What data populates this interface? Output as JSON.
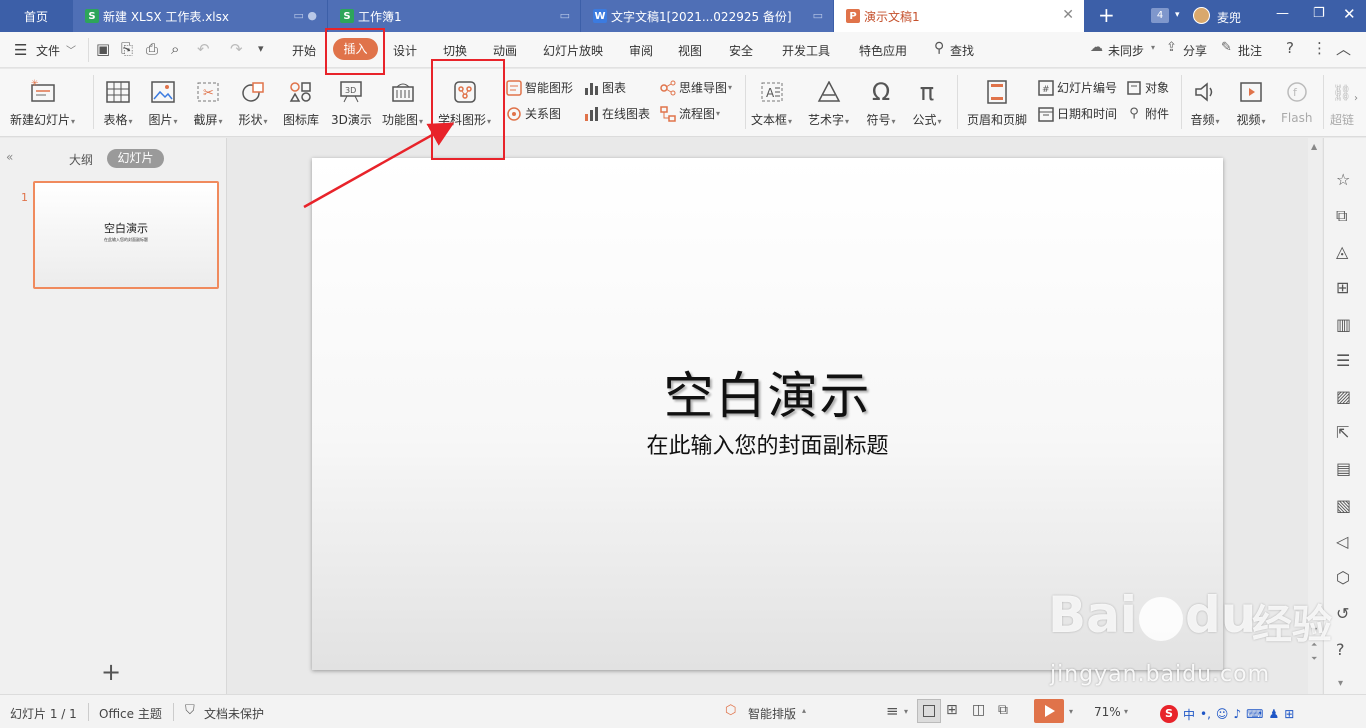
{
  "tabs": {
    "home": "首页",
    "tab1": "新建 XLSX 工作表.xlsx",
    "tab2": "工作簿1",
    "tab3": "文字文稿1[2021...022925 备份]",
    "tab4": "演示文稿1",
    "badge": "4",
    "user": "麦兜"
  },
  "menu": {
    "file": "文件",
    "items": [
      "开始",
      "插入",
      "设计",
      "切换",
      "动画",
      "幻灯片放映",
      "审阅",
      "视图",
      "安全",
      "开发工具",
      "特色应用"
    ],
    "search": "查找",
    "sync": "未同步",
    "share": "分享",
    "comment": "批注"
  },
  "ribbon": {
    "new_slide": "新建幻灯片",
    "table": "表格",
    "picture": "图片",
    "screenshot": "截屏",
    "shape": "形状",
    "icons": "图标库",
    "3d": "3D演示",
    "function_chart": "功能图",
    "subject_shape": "学科图形",
    "smart_shape": "智能图形",
    "chart": "图表",
    "relation": "关系图",
    "online_chart": "在线图表",
    "mindmap": "思维导图",
    "flowchart": "流程图",
    "textbox": "文本框",
    "wordart": "艺术字",
    "symbol": "符号",
    "formula": "公式",
    "header_footer": "页眉和页脚",
    "slide_number": "幻灯片编号",
    "datetime": "日期和时间",
    "object": "对象",
    "attachment": "附件",
    "audio": "音频",
    "video": "视频",
    "flash": "Flash",
    "more": "超链"
  },
  "leftpanel": {
    "outline": "大纲",
    "slides": "幻灯片",
    "thumb_num": "1",
    "thumb_title": "空白演示",
    "thumb_sub": "在此输入您的封面副标题",
    "add": "+"
  },
  "slide": {
    "title": "空白演示",
    "subtitle": "在此输入您的封面副标题"
  },
  "status": {
    "slide_pos": "幻灯片 1 / 1",
    "theme": "Office 主题",
    "protect": "文档未保护",
    "smart_layout": "智能排版",
    "zoom": "71%"
  },
  "watermark": {
    "brand": "Bai",
    "brand2": "du",
    "cn": "经验",
    "url": "jingyan.baidu.com"
  },
  "colors": {
    "titlebar": "#3c5fa8",
    "accent": "#e0734a",
    "highlight": "#e8232a"
  }
}
